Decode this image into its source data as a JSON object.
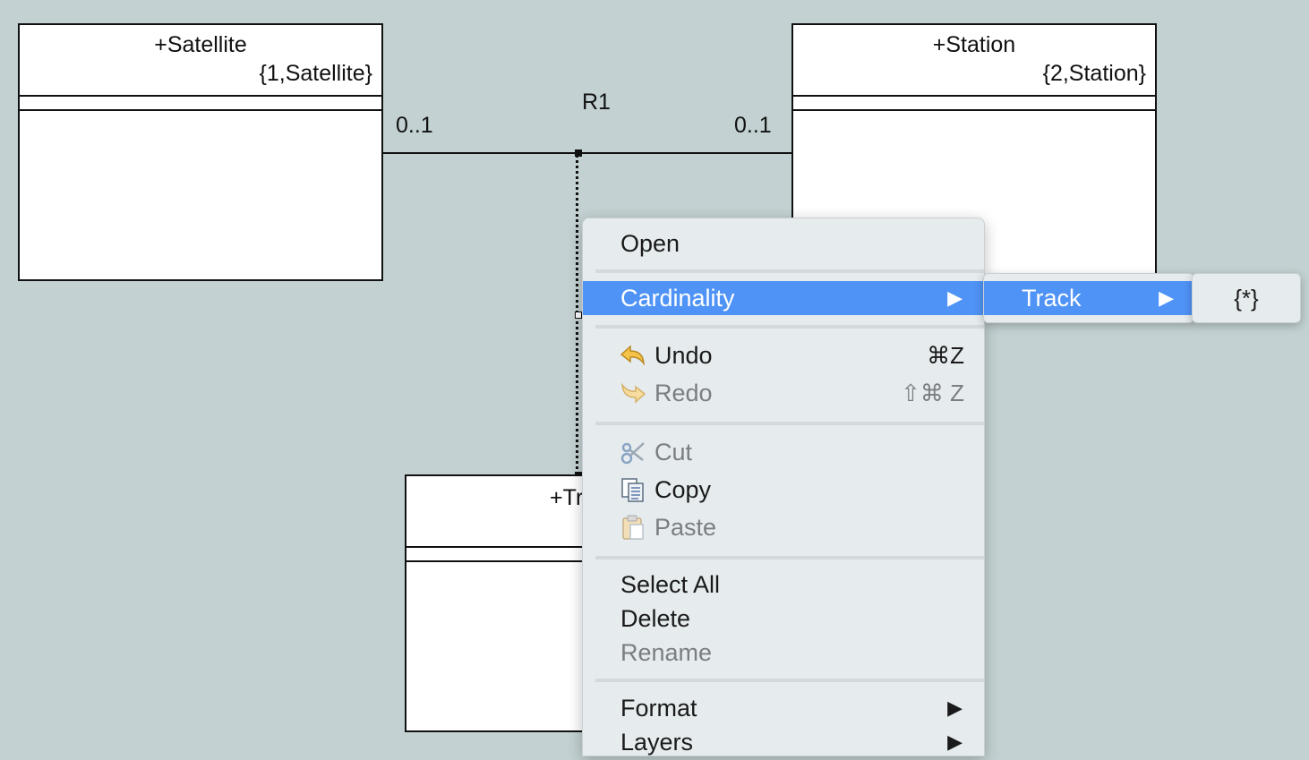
{
  "diagram": {
    "classes": [
      {
        "id": "satellite",
        "name": "+Satellite",
        "key": "{1,Satellite}"
      },
      {
        "id": "station",
        "name": "+Station",
        "key": "{2,Station}"
      },
      {
        "id": "track",
        "name": "+Tr"
      }
    ],
    "association": {
      "label": "R1",
      "left_multiplicity": "0..1",
      "right_multiplicity": "0..1"
    }
  },
  "context_menu": {
    "items": {
      "open": "Open",
      "cardinality": "Cardinality",
      "undo": "Undo",
      "undo_shortcut": "⌘Z",
      "redo": "Redo",
      "redo_shortcut": "⇧⌘ Z",
      "cut": "Cut",
      "copy": "Copy",
      "paste": "Paste",
      "select_all": "Select All",
      "delete": "Delete",
      "rename": "Rename",
      "format": "Format",
      "layers": "Layers"
    },
    "submenu": {
      "track": "Track"
    },
    "subsubmenu": {
      "value": "{*}"
    },
    "highlight_color": "#4f93f6"
  }
}
